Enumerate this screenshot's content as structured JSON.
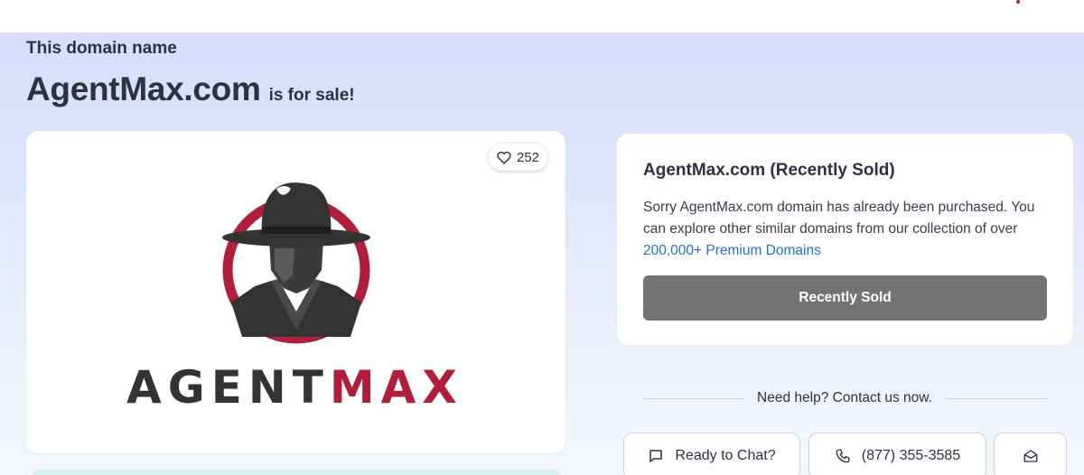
{
  "page": {
    "eyebrow": "This domain name",
    "domain": "AgentMax.com",
    "for_sale": "is for sale!"
  },
  "logo": {
    "likes": "252",
    "wordmark_part1": "AGENT",
    "wordmark_part2": "MAX",
    "brand_red": "#b01e3a",
    "brand_dark": "#333334"
  },
  "sold_card": {
    "title": "AgentMax.com (Recently Sold)",
    "message": "Sorry AgentMax.com domain has already been purchased. You can explore other similar domains from our collection of over",
    "link": "200,000+ Premium Domains",
    "button": "Recently Sold",
    "button_color": "#737373",
    "link_color": "#1f6fd6"
  },
  "help": {
    "heading": "Need help? Contact us now.",
    "chat_label": "Ready to Chat?",
    "phone_label": "(877) 355-3585",
    "chat_icon": "chat-bubble-icon",
    "phone_icon": "phone-icon",
    "email_icon": "envelope-open-icon"
  }
}
